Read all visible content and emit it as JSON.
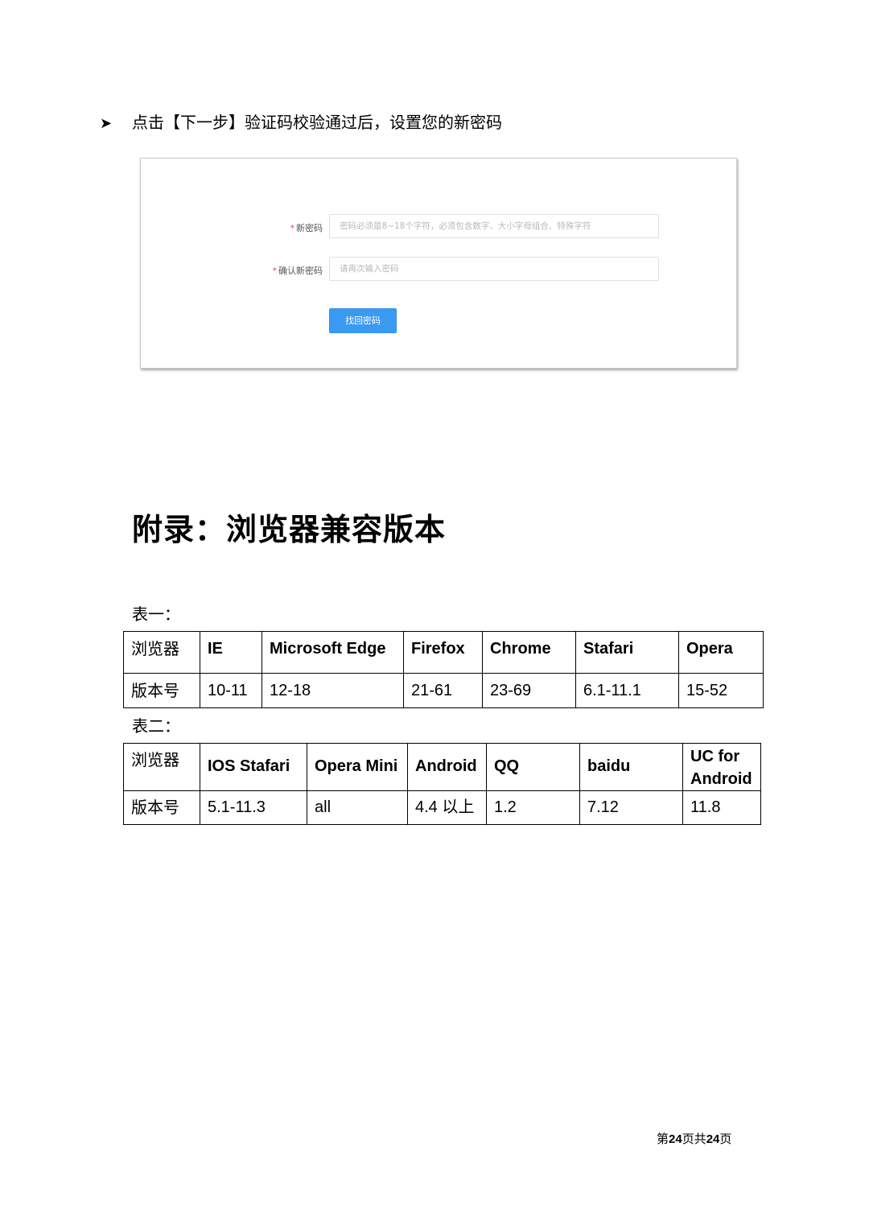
{
  "instruction": {
    "bullet": "➤",
    "text": "点击【下一步】验证码校验通过后，设置您的新密码"
  },
  "form": {
    "new_password_label": "新密码",
    "new_password_placeholder": "密码必须是8~18个字符，必须包含数字、大小字母组合、特殊字符",
    "confirm_password_label": "确认新密码",
    "confirm_password_placeholder": "请再次输入密码",
    "required_mark": "*",
    "submit_label": "找回密码"
  },
  "appendix": {
    "title": "附录：浏览器兼容版本"
  },
  "table1": {
    "caption": "表一：",
    "header": [
      "浏览器",
      "IE",
      "Microsoft Edge",
      "Firefox",
      "Chrome",
      "Stafari",
      "Opera"
    ],
    "row": [
      "版本号",
      "10-11",
      "12-18",
      "21-61",
      "23-69",
      "6.1-11.1",
      "15-52"
    ]
  },
  "table2": {
    "caption": "表二：",
    "header": [
      "浏览器",
      "IOS Stafari",
      "Opera Mini",
      "Android",
      "QQ",
      "baidu",
      "UC for Android"
    ],
    "row": [
      "版本号",
      "5.1-11.3",
      "all",
      "4.4 以上",
      "1.2",
      "7.12",
      "11.8"
    ]
  },
  "footer": {
    "prefix": "第",
    "current": "24",
    "middle": "页共",
    "total": "24",
    "suffix": "页"
  }
}
